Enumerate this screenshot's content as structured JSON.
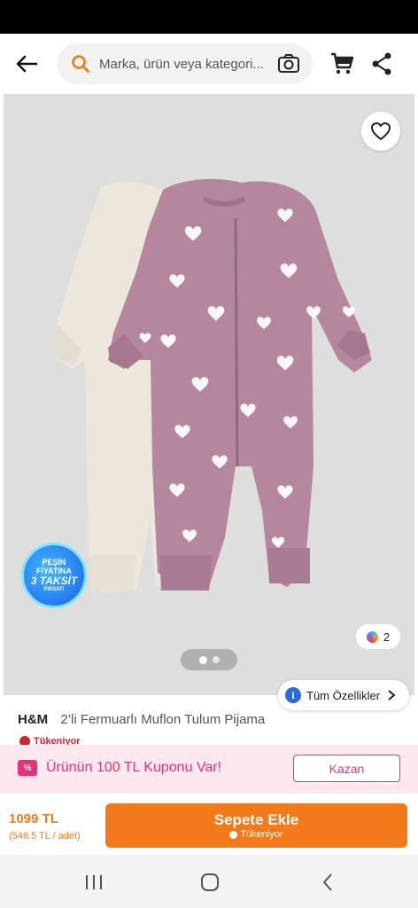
{
  "search": {
    "placeholder": "Marka, ürün veya kategori..."
  },
  "product": {
    "brand": "H&M",
    "name": "2’li Fermuarlı Muflon Tulum Pijama",
    "stock_status": "Tükeniyor",
    "color_count": "2",
    "specs_label": "Tüm Özellikler",
    "promo_badge": {
      "line1": "PEŞİN",
      "line2": "FİYATINA",
      "line3": "3 TAKSİT",
      "line4": "FIRSATI"
    },
    "gallery": {
      "current_page": 1,
      "total_pages": 2
    }
  },
  "coupon": {
    "tag": "%",
    "text": "Ürünün 100 TL Kuponu Var!",
    "button": "Kazan"
  },
  "buy": {
    "price": "1099 TL",
    "unit_price": "(549.5 TL / adet)",
    "add_to_cart": "Sepete Ekle",
    "add_to_cart_sub": "Tükeniyor"
  },
  "colors": {
    "brand": "#f27a1a",
    "coupon": "#e8317a",
    "stock_red": "#d4252f",
    "romper_pink": "#b5879f",
    "romper_cream": "#ece6db"
  },
  "icons": [
    "back-arrow-icon",
    "search-icon",
    "camera-icon",
    "cart-icon",
    "share-icon",
    "heart-icon",
    "info-icon",
    "chevron-right-icon",
    "clock-icon",
    "recent-apps-icon",
    "home-icon",
    "nav-back-icon"
  ]
}
